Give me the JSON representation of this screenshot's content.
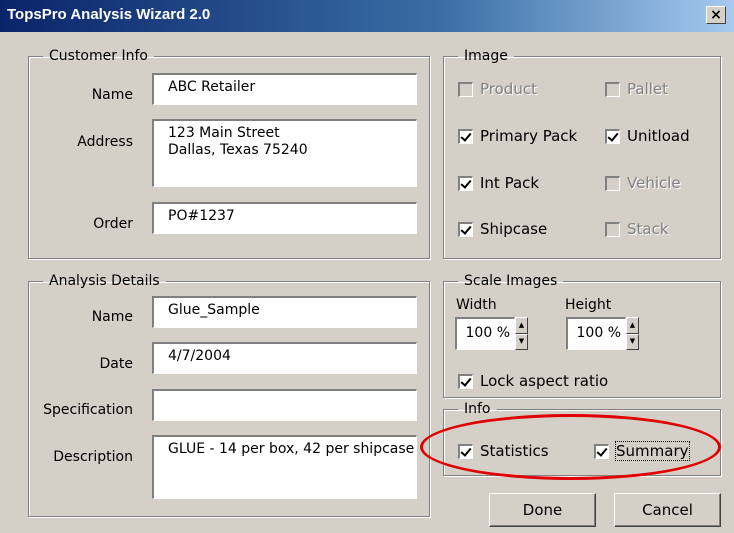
{
  "window": {
    "title": "TopsPro Analysis Wizard 2.0",
    "close_label": "×"
  },
  "customer_info": {
    "legend": "Customer Info",
    "name_label": "Name",
    "name_value": "ABC Retailer",
    "address_label": "Address",
    "address_value": "123 Main Street\nDallas, Texas 75240",
    "order_label": "Order",
    "order_value": "PO#1237"
  },
  "analysis_details": {
    "legend": "Analysis Details",
    "name_label": "Name",
    "name_value": "Glue_Sample",
    "date_label": "Date",
    "date_value": "4/7/2004",
    "spec_label": "Specification",
    "spec_value": "",
    "desc_label": "Description",
    "desc_value": "GLUE - 14 per box, 42 per shipcase"
  },
  "image": {
    "legend": "Image",
    "product": {
      "label": "Product",
      "checked": false,
      "enabled": false
    },
    "pallet": {
      "label": "Pallet",
      "checked": false,
      "enabled": false
    },
    "primary_pack": {
      "label": "Primary Pack",
      "checked": true,
      "enabled": true
    },
    "unitload": {
      "label": "Unitload",
      "checked": true,
      "enabled": true
    },
    "int_pack": {
      "label": "Int Pack",
      "checked": true,
      "enabled": true
    },
    "vehicle": {
      "label": "Vehicle",
      "checked": false,
      "enabled": false
    },
    "shipcase": {
      "label": "Shipcase",
      "checked": true,
      "enabled": true
    },
    "stack": {
      "label": "Stack",
      "checked": false,
      "enabled": false
    }
  },
  "scale_images": {
    "legend": "Scale Images",
    "width_label": "Width",
    "width_value": "100 %",
    "height_label": "Height",
    "height_value": "100 %",
    "lock_label": "Lock aspect ratio",
    "lock_checked": true
  },
  "info": {
    "legend": "Info",
    "statistics_label": "Statistics",
    "statistics_checked": true,
    "summary_label": "Summary",
    "summary_checked": true
  },
  "buttons": {
    "done": "Done",
    "cancel": "Cancel"
  },
  "colors": {
    "annotation": "#e00000",
    "title_start": "#0a246a",
    "dialog_bg": "#d4d0c8"
  }
}
